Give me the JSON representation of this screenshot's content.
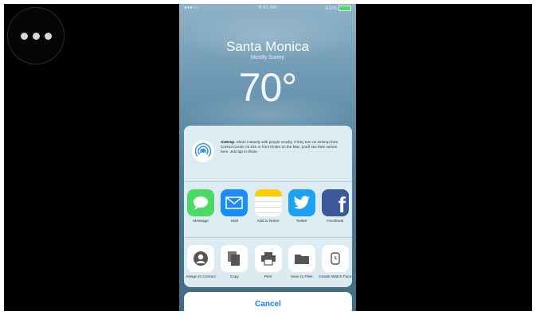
{
  "status_bar": {
    "carrier": "●●●○○",
    "time": "9:41 AM",
    "battery": "100%"
  },
  "weather": {
    "city": "Santa Monica",
    "condition": "Mostly Sunny",
    "temperature": "70°"
  },
  "airdrop": {
    "title": "AirDrop.",
    "description": " Share instantly with people nearby. If they turn on AirDrop from Control Center on iOS or from Finder on the Mac, you'll see their names here. Just tap to share."
  },
  "apps": [
    {
      "label": "Message",
      "icon": "message-icon",
      "color": "#4cd964"
    },
    {
      "label": "Mail",
      "icon": "mail-icon",
      "color": "#1a8cff"
    },
    {
      "label": "Add to Notes",
      "icon": "notes-icon",
      "color": "#ffffff"
    },
    {
      "label": "Twitter",
      "icon": "twitter-icon",
      "color": "#1da1f2"
    },
    {
      "label": "Facebook",
      "icon": "facebook-icon",
      "color": "#3b5998"
    }
  ],
  "actions": [
    {
      "label": "Assign to Contact",
      "icon": "contact-icon"
    },
    {
      "label": "Copy",
      "icon": "copy-icon"
    },
    {
      "label": "Print",
      "icon": "print-icon"
    },
    {
      "label": "Save to Files",
      "icon": "folder-icon"
    },
    {
      "label": "Create Watch Face",
      "icon": "watch-icon"
    }
  ],
  "cancel_label": "Cancel",
  "colors": {
    "accent": "#1a7cf5",
    "sheet": "#e2f0f6"
  }
}
